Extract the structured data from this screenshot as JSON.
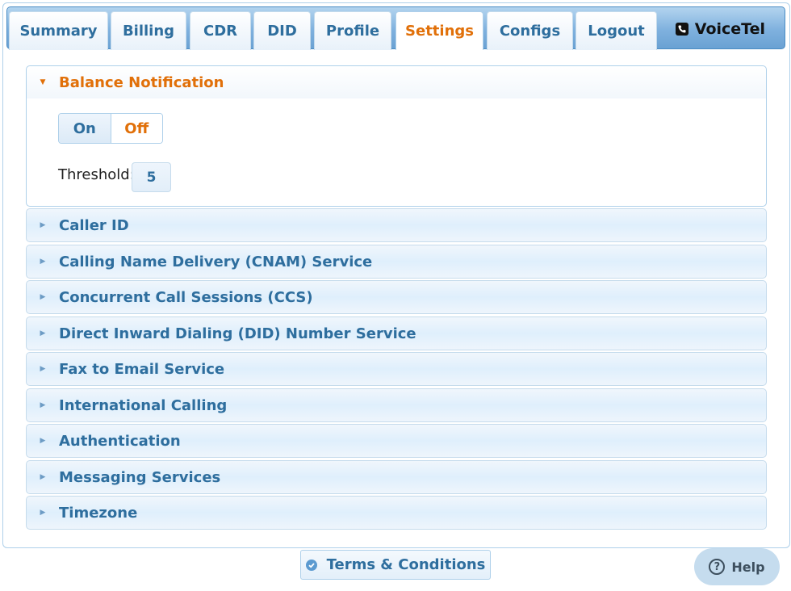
{
  "nav": {
    "tabs": [
      {
        "label": "Summary"
      },
      {
        "label": "Billing"
      },
      {
        "label": "CDR"
      },
      {
        "label": "DID"
      },
      {
        "label": "Profile"
      },
      {
        "label": "Settings",
        "active": true
      },
      {
        "label": "Configs"
      },
      {
        "label": "Logout"
      }
    ],
    "brand": "VoiceTel",
    "brand_icon": "phone-icon"
  },
  "sections": {
    "balance": {
      "title": "Balance Notification",
      "expanded": true,
      "toggle": {
        "on_label": "On",
        "off_label": "Off",
        "selected": "Off"
      },
      "threshold_label": "Threshold:",
      "threshold_value": "5"
    },
    "collapsed": [
      {
        "title": "Caller ID"
      },
      {
        "title": "Calling Name Delivery (CNAM) Service"
      },
      {
        "title": "Concurrent Call Sessions (CCS)"
      },
      {
        "title": "Direct Inward Dialing (DID) Number Service"
      },
      {
        "title": "Fax to Email Service"
      },
      {
        "title": "International Calling"
      },
      {
        "title": "Authentication"
      },
      {
        "title": "Messaging Services"
      },
      {
        "title": "Timezone"
      }
    ]
  },
  "footer": {
    "terms_label": "Terms & Conditions",
    "help_label": "Help"
  },
  "colors": {
    "accent": "#e17009",
    "link_blue": "#2e6e9e",
    "tabbar_blue": "#7fb1de"
  }
}
